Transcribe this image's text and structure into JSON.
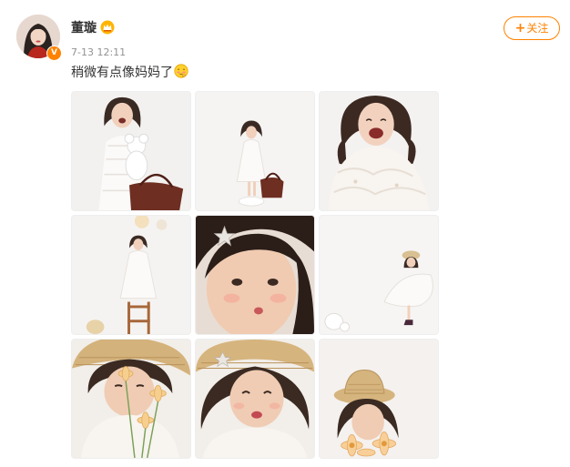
{
  "author": {
    "name": "董璇",
    "verified_badge": "V",
    "avatar_icon": "avatar-portrait",
    "member_icon": "vip-crown-icon"
  },
  "post": {
    "timestamp": "7-13 12:11",
    "text": "稍微有点像妈妈了",
    "emoji_icon": "shy-face-emoji"
  },
  "follow_button": {
    "plus": "+",
    "label": "关注"
  },
  "colors": {
    "accent": "#ff8200",
    "text": "#333333",
    "muted": "#939393"
  },
  "photos": [
    {
      "id": 1,
      "subject": "girl-with-bear-and-bag"
    },
    {
      "id": 2,
      "subject": "girl-standing-with-bag"
    },
    {
      "id": 3,
      "subject": "girl-laughing-closeup"
    },
    {
      "id": 4,
      "subject": "girl-on-ladder"
    },
    {
      "id": 5,
      "subject": "girl-face-closeup-star-clip"
    },
    {
      "id": 6,
      "subject": "girl-jumping-with-hat"
    },
    {
      "id": 7,
      "subject": "girl-with-straw-hat-flowers"
    },
    {
      "id": 8,
      "subject": "girl-pouting-straw-hat"
    },
    {
      "id": 9,
      "subject": "girl-holding-straw-hat-flowers"
    }
  ]
}
